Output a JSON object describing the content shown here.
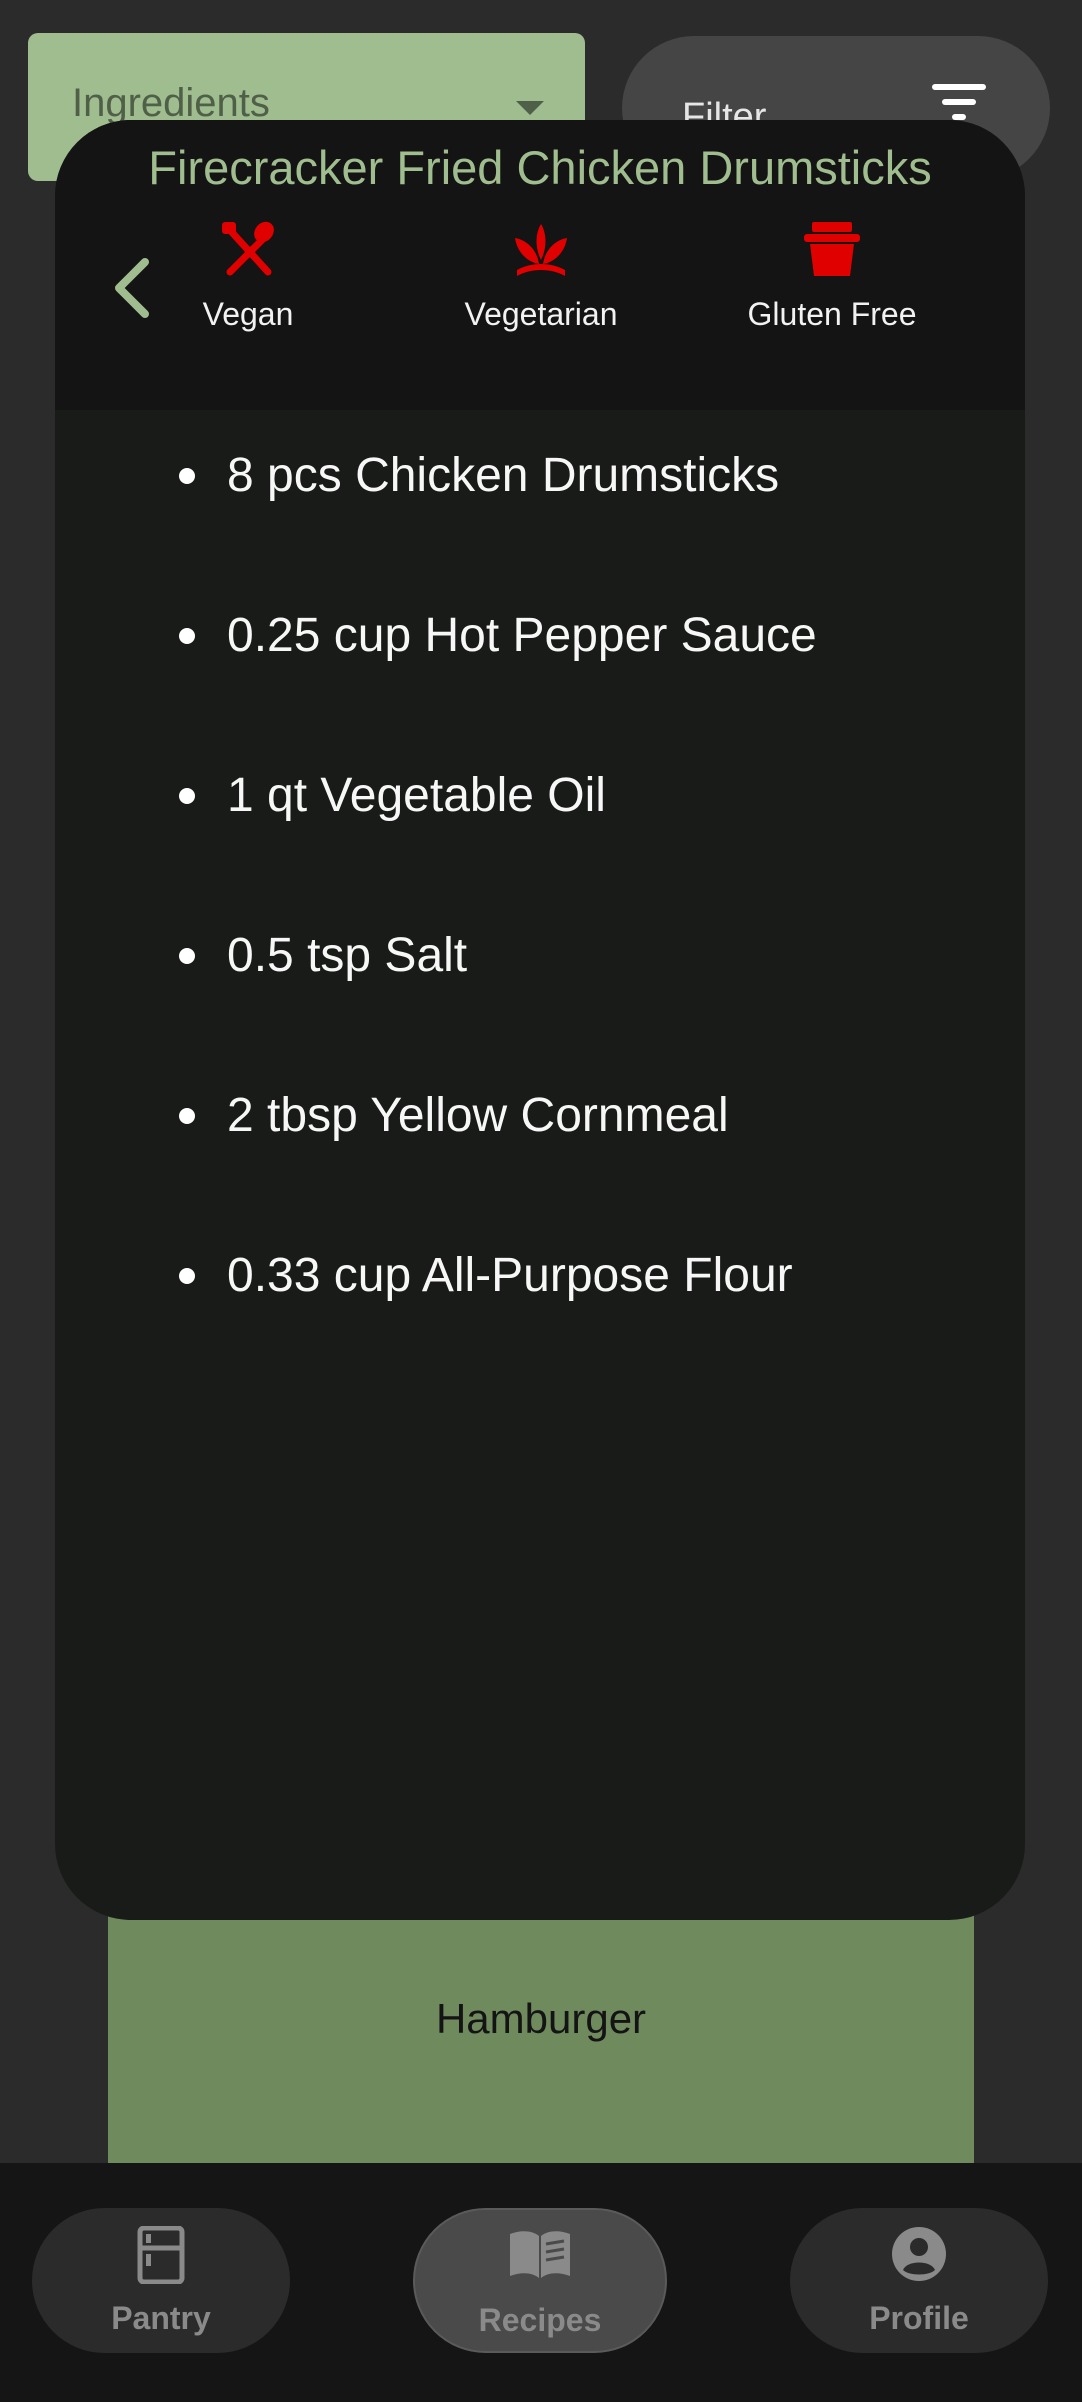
{
  "filter_bar": {
    "dropdown_label": "Ingredients",
    "filter_label": "Filter"
  },
  "background_card": {
    "title": "Hamburger"
  },
  "recipe": {
    "title": "Firecracker Fried Chicken Drumsticks",
    "diets": [
      {
        "label": "Vegan",
        "icon": "utensils-icon",
        "color": "#e00000"
      },
      {
        "label": "Vegetarian",
        "icon": "plant-icon",
        "color": "#e00000"
      },
      {
        "label": "Gluten Free",
        "icon": "bread-icon",
        "color": "#e00000"
      }
    ],
    "ingredients": [
      "8 pcs Chicken Drumsticks",
      "0.25 cup Hot Pepper Sauce",
      "1 qt Vegetable Oil",
      "0.5 tsp Salt",
      "2 tbsp Yellow Cornmeal",
      "0.33 cup All-Purpose Flour"
    ]
  },
  "bottom_nav": {
    "items": [
      {
        "label": "Pantry",
        "icon": "fridge-icon"
      },
      {
        "label": "Recipes",
        "icon": "book-icon",
        "active": true
      },
      {
        "label": "Profile",
        "icon": "account-circle-icon"
      }
    ]
  },
  "colors": {
    "accent": "#a0bd8f",
    "diet_icon": "#e00000",
    "card": "#6f8b5e"
  }
}
